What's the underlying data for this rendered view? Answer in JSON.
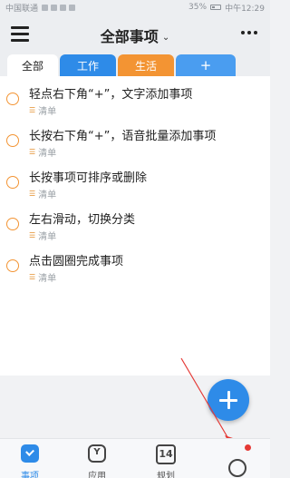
{
  "status_bar": {
    "carrier": "中国联通",
    "battery": "35%",
    "time": "中午12:29"
  },
  "header": {
    "title": "全部事项"
  },
  "tabs": [
    {
      "label": "全部"
    },
    {
      "label": "工作"
    },
    {
      "label": "生活"
    },
    {
      "label": "+"
    }
  ],
  "tasks": [
    {
      "title": "轻点右下角“+”，文字添加事项",
      "tag": "清单"
    },
    {
      "title": "长按右下角“+”，语音批量添加事项",
      "tag": "清单"
    },
    {
      "title": "长按事项可排序或删除",
      "tag": "清单"
    },
    {
      "title": "左右滑动，切换分类",
      "tag": "清单"
    },
    {
      "title": "点击圆圈完成事项",
      "tag": "清单"
    }
  ],
  "bottom_nav": [
    {
      "label": "事项"
    },
    {
      "label": "应用"
    },
    {
      "label": "规划",
      "icon_text": "14"
    },
    {
      "label": ""
    }
  ],
  "colors": {
    "accent_blue": "#2e8be8",
    "work_tab": "#2e8be8",
    "life_tab": "#f39433",
    "add_tab": "#4a9df0",
    "circle": "#f39433",
    "annotation_red": "#e53935"
  },
  "icons": {
    "menu": "hamburger-icon",
    "title_dropdown": "chevron-down-icon",
    "more": "more-dots-icon",
    "fab": "plus-icon",
    "list": "list-icon"
  }
}
